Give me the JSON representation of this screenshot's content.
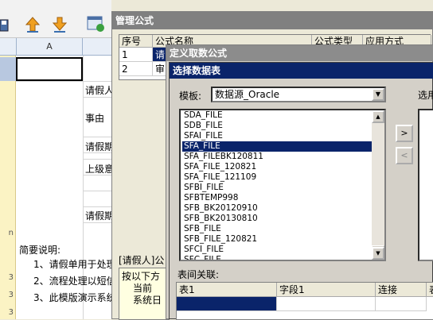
{
  "sheet": {
    "column_header": "A",
    "cells": {
      "leave_person": "请假人",
      "reason": "事由",
      "leave_period": "请假期",
      "superior_opinion": "上级意",
      "leave_period2": "请假期",
      "brief_label": "简要说明:",
      "note1": "1、请假单用于处理",
      "note2": "2、流程处理以短信",
      "note3": "3、此模版演示系统"
    }
  },
  "manage_window": {
    "title": "管理公式",
    "columns": [
      "序号",
      "公式名称",
      "公式类型",
      "应用方式"
    ],
    "rows": [
      {
        "no": "1",
        "name": "请"
      },
      {
        "no": "2",
        "name": "审"
      }
    ],
    "section_label": "[请假人]公",
    "info_lines": [
      "按以下方",
      "当前",
      "系统日"
    ]
  },
  "define_window": {
    "title": "定义取数公式"
  },
  "select_dialog": {
    "title": "选择数据表",
    "template_label": "模板:",
    "template_value": "数据源_Oracle",
    "right_label": "选用",
    "move_right": ">",
    "move_left": "<",
    "tables": [
      "SDA_FILE",
      "SDB_FILE",
      "SFAI_FILE",
      "SFA_FILE",
      "SFA_FILEBK120811",
      "SFA_FILE_120821",
      "SFA_FILE_121109",
      "SFBI_FILE",
      "SFBTEMP998",
      "SFB_BK20120910",
      "SFB_BK20130810",
      "SFB_FILE",
      "SFB_FILE_120821",
      "SFCI_FILE",
      "SFC_FILE"
    ],
    "selected_table": "SFA_FILE",
    "relation_label": "表间关联:",
    "relation_columns": [
      "表1",
      "字段1",
      "连接",
      "表"
    ]
  }
}
